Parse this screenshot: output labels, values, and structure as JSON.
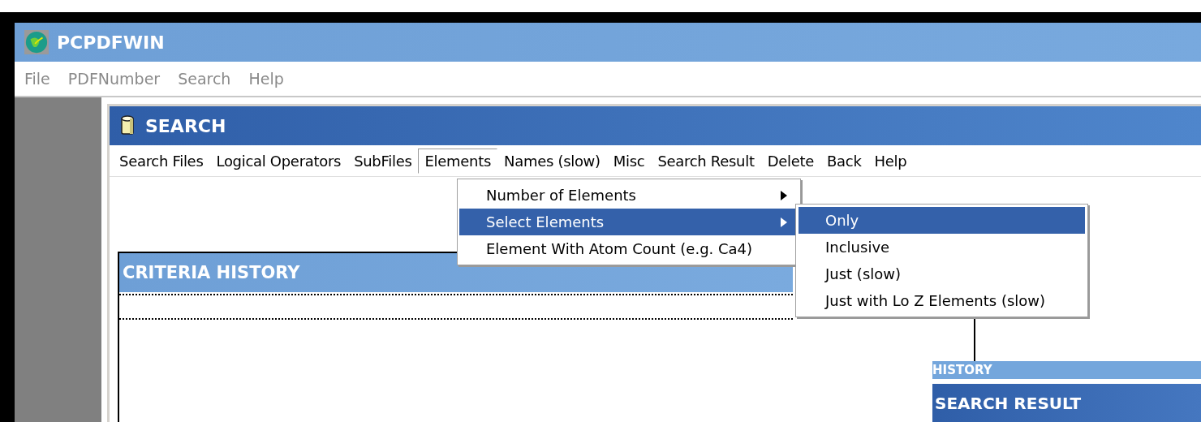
{
  "window": {
    "title": "PCPDFWIN"
  },
  "menu_bar": [
    {
      "label": "File",
      "disabled": true
    },
    {
      "label": "PDFNumber",
      "disabled": true
    },
    {
      "label": "Search",
      "disabled": true
    },
    {
      "label": "Help",
      "disabled": true
    }
  ],
  "search_window": {
    "title": "SEARCH",
    "menu_bar": [
      {
        "label": "Search Files",
        "selected": false
      },
      {
        "label": "Logical Operators",
        "selected": false
      },
      {
        "label": "SubFiles",
        "selected": false
      },
      {
        "label": "Elements",
        "selected": true
      },
      {
        "label": "Names (slow)",
        "selected": false
      },
      {
        "label": "Misc",
        "selected": false
      },
      {
        "label": "Search Result",
        "selected": false
      },
      {
        "label": "Delete",
        "selected": false
      },
      {
        "label": "Back",
        "selected": false
      },
      {
        "label": "Help",
        "selected": false
      }
    ],
    "elements_menu": [
      {
        "label": "Number of Elements",
        "submenu": true,
        "selected": false
      },
      {
        "label": "Select Elements",
        "submenu": true,
        "selected": true
      },
      {
        "label": "Element With Atom Count (e.g. Ca4)",
        "submenu": false,
        "selected": false
      }
    ],
    "select_elements_submenu": [
      {
        "label": "Only",
        "selected": true
      },
      {
        "label": "Inclusive",
        "selected": false
      },
      {
        "label": "Just (slow)",
        "selected": false
      },
      {
        "label": "Just with Lo Z Elements (slow)",
        "selected": false
      }
    ],
    "criteria_history": {
      "title": "CRITERIA HISTORY"
    },
    "history": {
      "title": "HISTORY"
    },
    "search_result": {
      "title": "SEARCH RESULT"
    }
  }
}
